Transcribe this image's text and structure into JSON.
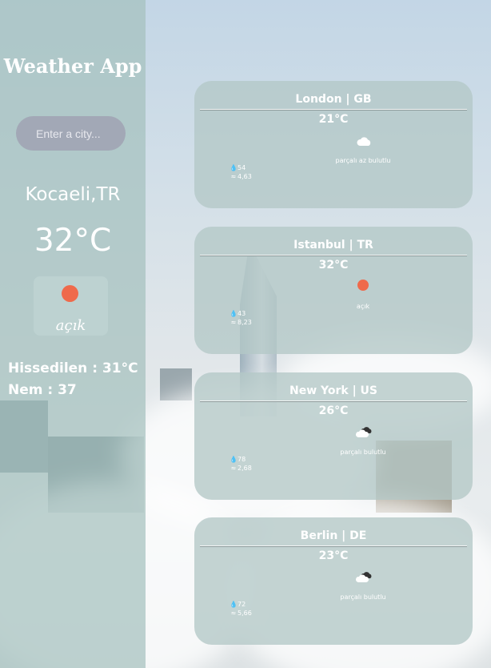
{
  "sidebar": {
    "title": "Weather App",
    "search_placeholder": "Enter a city...",
    "city": "Kocaeli,TR",
    "temperature": "32°C",
    "icon": "sun-icon",
    "description": "açık",
    "feels_like": "Hissedilen : 31°C",
    "humidity": "Nem : 37"
  },
  "cards": [
    {
      "title": "London | GB",
      "temp": "21°C",
      "icon": "cloud-icon",
      "desc": "parçalı az bulutlu",
      "humidity": "54",
      "wind": "4,63"
    },
    {
      "title": "Istanbul | TR",
      "temp": "32°C",
      "icon": "sun-icon",
      "desc": "açık",
      "humidity": "43",
      "wind": "8,23"
    },
    {
      "title": "New York | US",
      "temp": "26°C",
      "icon": "broken-clouds-icon",
      "desc": "parçalı bulutlu",
      "humidity": "78",
      "wind": "2,68"
    },
    {
      "title": "Berlin | DE",
      "temp": "23°C",
      "icon": "broken-clouds-icon",
      "desc": "parçalı bulutlu",
      "humidity": "72",
      "wind": "5,66"
    }
  ],
  "colors": {
    "sun": "#ef6a4b",
    "sidebar": "#a5c0be",
    "card": "#b4c8c6",
    "search": "#a2a8b6"
  }
}
